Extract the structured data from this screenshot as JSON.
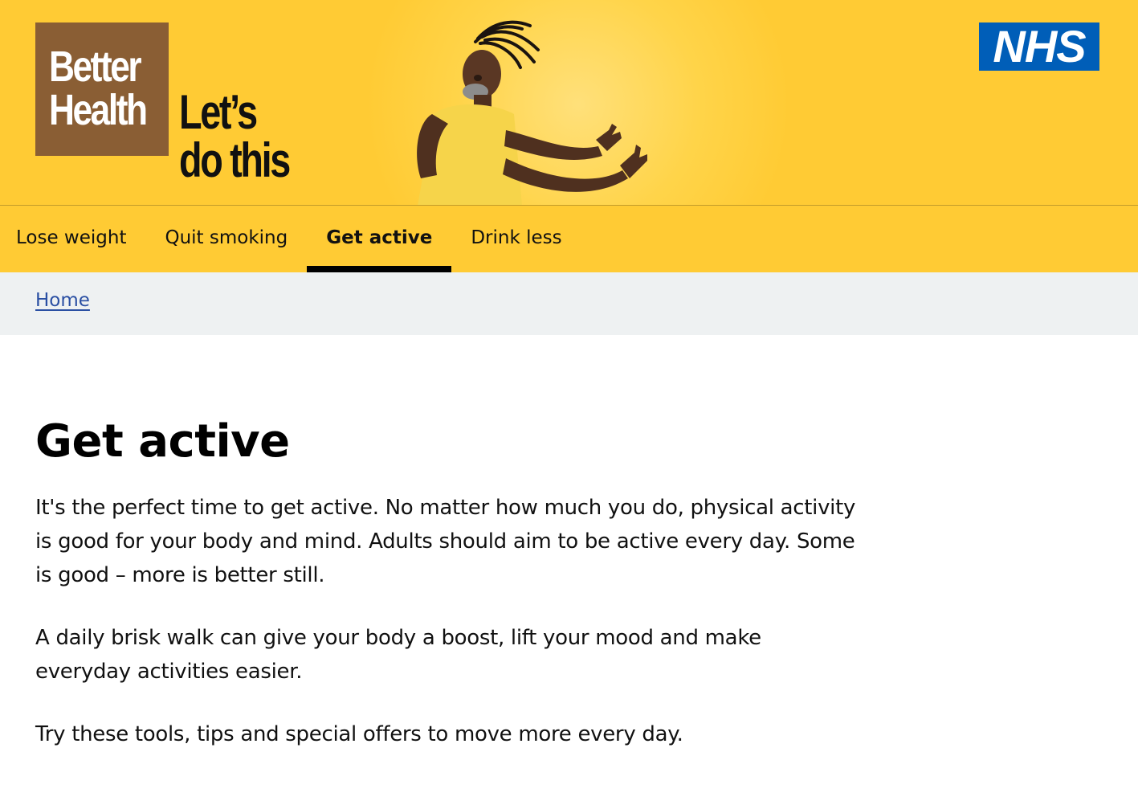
{
  "header": {
    "brand_line1": "Better",
    "brand_line2": "Health",
    "tagline_line1": "Let’s",
    "tagline_line2": "do this",
    "nhs_logo": "NHS",
    "colors": {
      "header_bg": "#ffcb34",
      "brand_bg": "#8a5e34",
      "nhs_blue": "#005eb8"
    }
  },
  "nav": {
    "items": [
      {
        "label": "Lose weight"
      },
      {
        "label": "Quit smoking"
      },
      {
        "label": "Get active",
        "active": true
      },
      {
        "label": "Drink less"
      }
    ]
  },
  "breadcrumb": {
    "home": "Home"
  },
  "main": {
    "title": "Get active",
    "paragraphs": [
      "It's the perfect time to get active. No matter how much you do, physical activity is good for your body and mind. Adults should aim to be active every day. Some is good – more is better still.",
      "A daily brisk walk can give your body a boost, lift your mood and make everyday activities easier.",
      "Try these tools, tips and special offers to move more every day."
    ]
  }
}
